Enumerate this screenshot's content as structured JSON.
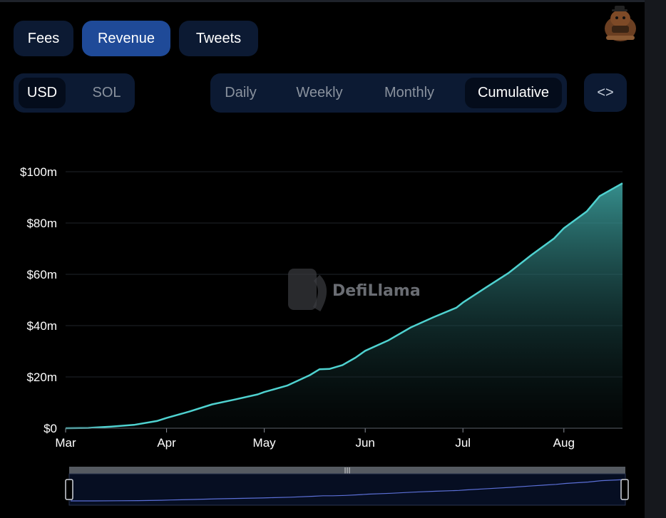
{
  "tabs": [
    {
      "label": "Fees",
      "active": false
    },
    {
      "label": "Revenue",
      "active": true
    },
    {
      "label": "Tweets",
      "active": false
    }
  ],
  "currency": {
    "options": [
      {
        "label": "USD",
        "active": true
      },
      {
        "label": "SOL",
        "active": false
      }
    ]
  },
  "period": {
    "options": [
      {
        "label": "Daily",
        "active": false
      },
      {
        "label": "Weekly",
        "active": false
      },
      {
        "label": "Monthly",
        "active": false
      },
      {
        "label": "Cumulative",
        "active": true
      }
    ]
  },
  "embed_button": {
    "icon": "code-icon",
    "label": "<>"
  },
  "watermark": {
    "text": "DefiLlama"
  },
  "colors": {
    "accent": "#1f4a98",
    "line": "#4fd2d0",
    "button_bg": "#0c1a33",
    "brush": "#5b6fd6"
  },
  "chart_data": {
    "type": "area",
    "title": "",
    "xlabel": "",
    "ylabel": "",
    "y_unit": "$m",
    "ylim": [
      0,
      100
    ],
    "y_ticks": [
      {
        "value": 0,
        "label": "$0"
      },
      {
        "value": 20,
        "label": "$20m"
      },
      {
        "value": 40,
        "label": "$40m"
      },
      {
        "value": 60,
        "label": "$60m"
      },
      {
        "value": 80,
        "label": "$80m"
      },
      {
        "value": 100,
        "label": "$100m"
      }
    ],
    "x_ticks": [
      "Mar",
      "Apr",
      "May",
      "Jun",
      "Jul",
      "Aug"
    ],
    "grid": true,
    "series": [
      {
        "x": [
          "2024-03-01",
          "2024-03-08",
          "2024-03-15",
          "2024-03-22",
          "2024-03-29",
          "2024-04-01",
          "2024-04-08",
          "2024-04-15",
          "2024-04-22",
          "2024-04-29",
          "2024-05-01",
          "2024-05-08",
          "2024-05-15",
          "2024-05-18",
          "2024-05-21",
          "2024-05-25",
          "2024-05-29",
          "2024-06-01",
          "2024-06-08",
          "2024-06-15",
          "2024-06-22",
          "2024-06-29",
          "2024-07-01",
          "2024-07-08",
          "2024-07-15",
          "2024-07-22",
          "2024-07-29",
          "2024-08-01",
          "2024-08-08",
          "2024-08-12",
          "2024-08-19"
        ],
        "values": [
          0,
          0.1,
          0.6,
          1.3,
          2.8,
          4.0,
          6.5,
          9.3,
          11.2,
          13.2,
          14.1,
          16.6,
          20.7,
          23.0,
          23.1,
          24.6,
          27.5,
          30.2,
          34.2,
          39.3,
          43.3,
          47.0,
          49.0,
          54.8,
          60.5,
          67.5,
          74.0,
          78.0,
          84.5,
          90.5,
          95.5
        ]
      }
    ],
    "brush": {
      "range_fraction": [
        0,
        1
      ]
    }
  }
}
